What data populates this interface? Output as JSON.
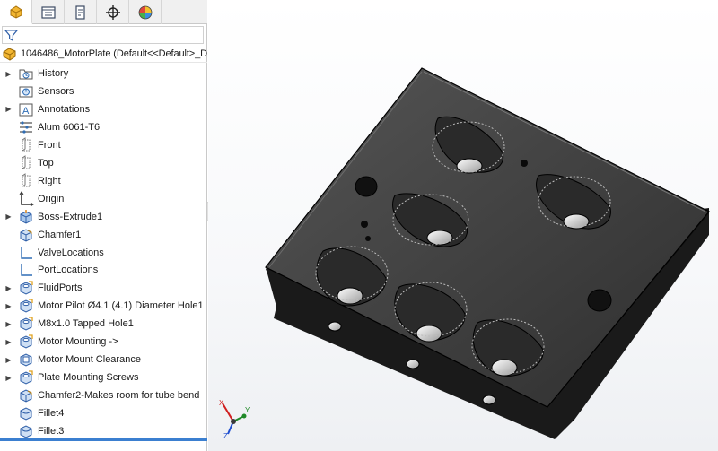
{
  "tabs": [
    {
      "name": "feature-manager",
      "icon": "feature-manager-icon"
    },
    {
      "name": "property-manager",
      "icon": "property-manager-icon"
    },
    {
      "name": "configuration-manager",
      "icon": "configuration-manager-icon"
    },
    {
      "name": "dimxpert-manager",
      "icon": "crosshair-icon"
    },
    {
      "name": "display-manager",
      "icon": "display-pie-icon"
    }
  ],
  "filter": {
    "icon": "filter-icon"
  },
  "root": {
    "label": "1046486_MotorPlate  (Default<<Default>_D"
  },
  "tree": [
    {
      "label": "History",
      "icon": "history-folder-icon",
      "expander": true
    },
    {
      "label": "Sensors",
      "icon": "sensors-icon",
      "expander": false
    },
    {
      "label": "Annotations",
      "icon": "annotations-icon",
      "expander": true
    },
    {
      "label": "Alum 6061-T6",
      "icon": "material-icon",
      "expander": false
    },
    {
      "label": "Front",
      "icon": "plane-icon",
      "expander": false
    },
    {
      "label": "Top",
      "icon": "plane-icon",
      "expander": false
    },
    {
      "label": "Right",
      "icon": "plane-icon",
      "expander": false
    },
    {
      "label": "Origin",
      "icon": "origin-icon",
      "expander": false
    },
    {
      "label": "Boss-Extrude1",
      "icon": "boss-extrude-icon",
      "expander": true
    },
    {
      "label": "Chamfer1",
      "icon": "chamfer-icon",
      "expander": false
    },
    {
      "label": "ValveLocations",
      "icon": "sketch-icon",
      "expander": false
    },
    {
      "label": "PortLocations",
      "icon": "sketch-icon",
      "expander": false
    },
    {
      "label": "FluidPorts",
      "icon": "hole-wizard-icon",
      "expander": true
    },
    {
      "label": "Motor Pilot Ø4.1 (4.1) Diameter Hole1",
      "icon": "hole-wizard-icon",
      "expander": true
    },
    {
      "label": "M8x1.0 Tapped Hole1",
      "icon": "hole-wizard-icon",
      "expander": true
    },
    {
      "label": "Motor Mounting ->",
      "icon": "hole-wizard-icon",
      "expander": true
    },
    {
      "label": "Motor Mount Clearance",
      "icon": "cut-extrude-icon",
      "expander": true
    },
    {
      "label": "Plate Mounting Screws",
      "icon": "hole-wizard-icon",
      "expander": true
    },
    {
      "label": "Chamfer2-Makes room for tube bend",
      "icon": "chamfer-icon",
      "expander": false
    },
    {
      "label": "Fillet4",
      "icon": "fillet-icon",
      "expander": false
    },
    {
      "label": "Fillet3",
      "icon": "fillet-icon",
      "expander": false
    }
  ],
  "triad": {
    "x_label": "X",
    "y_label": "Y",
    "z_label": "Z"
  }
}
